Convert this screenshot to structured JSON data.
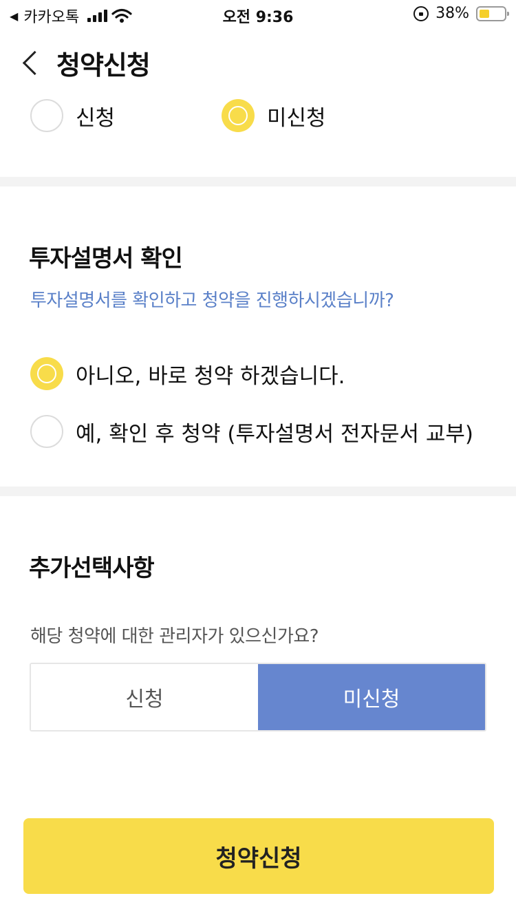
{
  "status_bar": {
    "carrier": "카카오톡",
    "time": "오전 9:36",
    "battery_percent": "38%",
    "battery_level": 0.38
  },
  "header": {
    "title": "청약신청"
  },
  "top_options": {
    "selected": "미신청",
    "options": [
      {
        "label": "신청",
        "checked": false
      },
      {
        "label": "미신청",
        "checked": true
      }
    ]
  },
  "prospectus": {
    "title": "투자설명서 확인",
    "question": "투자설명서를 확인하고 청약을 진행하시겠습니까?",
    "options": [
      {
        "label": "아니오, 바로 청약 하겠습니다.",
        "checked": true
      },
      {
        "label": "예, 확인 후 청약 (투자설명서 전자문서 교부)",
        "checked": false
      }
    ]
  },
  "additional": {
    "title": "추가선택사항",
    "question": "해당 청약에 대한 관리자가 있으신가요?",
    "options": [
      {
        "label": "신청",
        "selected": false
      },
      {
        "label": "미신청",
        "selected": true
      }
    ]
  },
  "submit_label": "청약신청",
  "colors": {
    "accent_yellow": "#f8dc4a",
    "accent_blue": "#6686cf",
    "question_blue": "#5a80c8"
  }
}
